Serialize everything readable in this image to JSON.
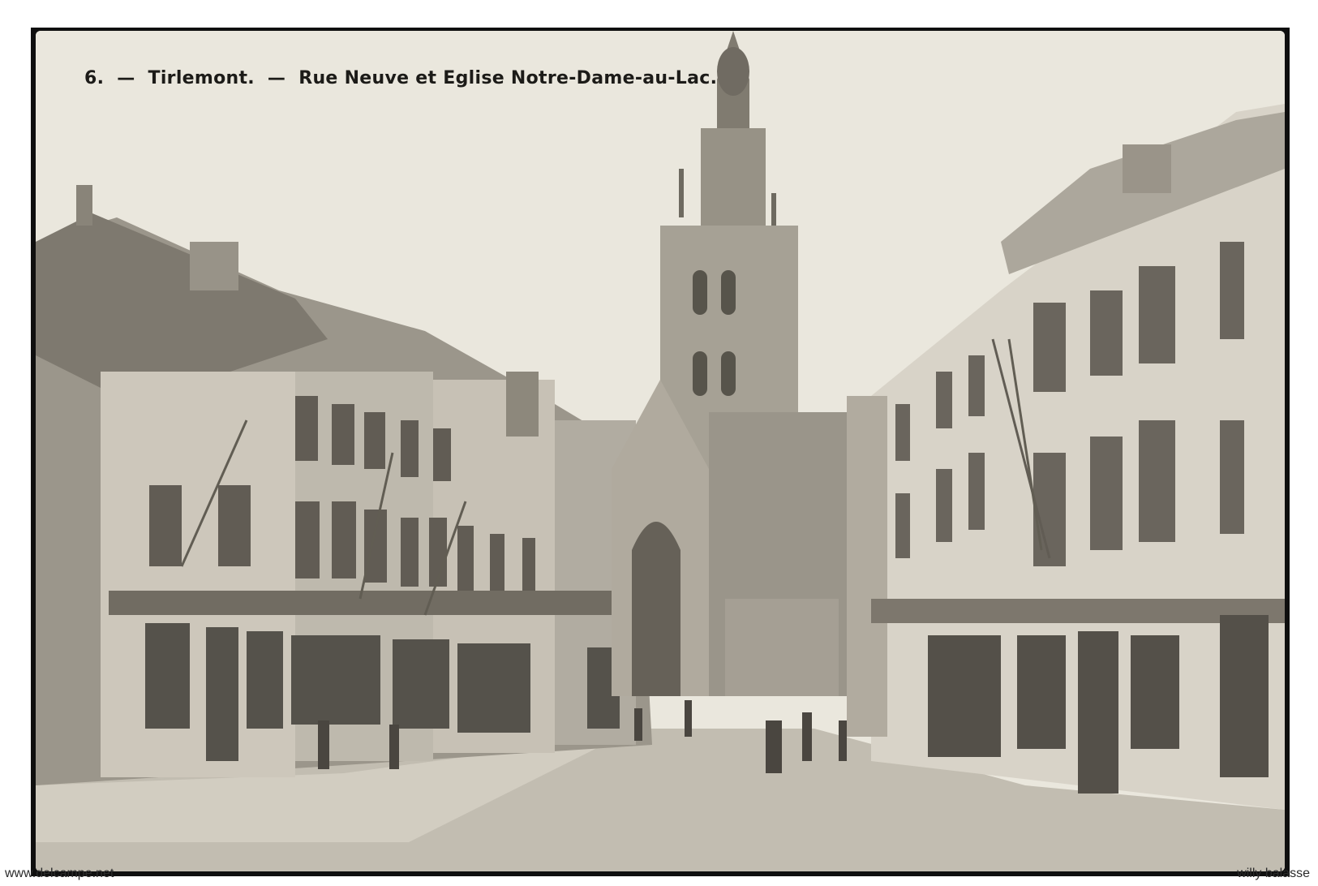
{
  "postcard": {
    "number": "6.",
    "sep1": "—",
    "town": "Tirlemont.",
    "sep2": "—",
    "title": "Rue Neuve et Eglise Notre-Dame-au-Lac."
  },
  "watermarks": {
    "left": "www.delcampe.net",
    "right": "willy balasse"
  },
  "colors": {
    "paper": "#e9e6dd",
    "ink": "#1c1b18",
    "frame": "#0f0f0f"
  }
}
